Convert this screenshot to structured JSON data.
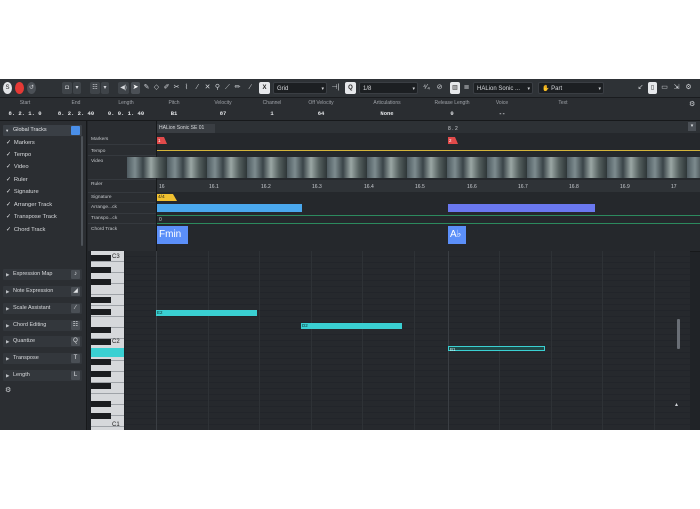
{
  "toolbar": {
    "grid_label": "Grid",
    "quantize_value": "1/8",
    "instrument_name": "HALion Sonic ...",
    "part_label": "Part"
  },
  "infoline": {
    "columns": [
      {
        "header": "Start",
        "value": "8. 2. 1.   0"
      },
      {
        "header": "End",
        "value": "8. 2. 2. 40"
      },
      {
        "header": "Length",
        "value": "0. 0. 1. 40"
      },
      {
        "header": "Pitch",
        "value": "B1"
      },
      {
        "header": "Velocity",
        "value": "87"
      },
      {
        "header": "Channel",
        "value": "1"
      },
      {
        "header": "Off Velocity",
        "value": "64"
      },
      {
        "header": "Articulations",
        "value": "None"
      },
      {
        "header": "Release Length",
        "value": "0"
      },
      {
        "header": "Voice",
        "value": "--"
      },
      {
        "header": "Text",
        "value": ""
      }
    ]
  },
  "inspector": {
    "global_tracks_title": "Global Tracks",
    "global_tracks": [
      "Markers",
      "Tempo",
      "Video",
      "Ruler",
      "Signature",
      "Arranger Track",
      "Transpose Track",
      "Chord Track"
    ],
    "sections": [
      {
        "label": "Expression Map",
        "icon": "expression-map-icon",
        "glyph": "♪"
      },
      {
        "label": "Note Expression",
        "icon": "note-expression-icon",
        "glyph": "◢"
      },
      {
        "label": "Scale Assistant",
        "icon": "scale-assistant-icon",
        "glyph": "∕"
      },
      {
        "label": "Chord Editing",
        "icon": "chord-editing-icon",
        "glyph": "☷"
      },
      {
        "label": "Quantize",
        "icon": "quantize-icon",
        "glyph": "Q"
      },
      {
        "label": "Transpose",
        "icon": "transpose-icon",
        "glyph": "T"
      },
      {
        "label": "Length",
        "icon": "length-icon",
        "glyph": "L"
      }
    ]
  },
  "editor": {
    "part_name": "HALion Sonic SE 01",
    "marker_labels": [
      "1",
      "2"
    ],
    "marker_pos_label": "8 . 2",
    "track_rows": [
      "Markers",
      "Tempo",
      "Video",
      "Ruler",
      "Signature",
      "Arrange...ck",
      "Transpo...ck",
      "Chord Track"
    ],
    "ruler_ticks": [
      "16",
      "16.1",
      "16.2",
      "16.3",
      "16.4",
      "16.5",
      "16.6",
      "16.7",
      "16.8",
      "16.9",
      "17"
    ],
    "signature_value": "4/4",
    "transpose_value": "0",
    "chords": [
      "Fmin",
      "A♭"
    ],
    "keyboard_labels": [
      "C3",
      "C2",
      "C1"
    ],
    "notes": [
      {
        "label": "E2",
        "selected": false
      },
      {
        "label": "D2",
        "selected": false
      },
      {
        "label": "B1",
        "selected": true
      }
    ]
  },
  "colors": {
    "accent_blue": "#5b8ff9",
    "note_cyan": "#3ad0d2",
    "marker_red": "#e14a4a",
    "signature_yellow": "#f0c030",
    "arranger_blue": "#4aa8ee",
    "arranger_purple": "#6a78f0"
  }
}
